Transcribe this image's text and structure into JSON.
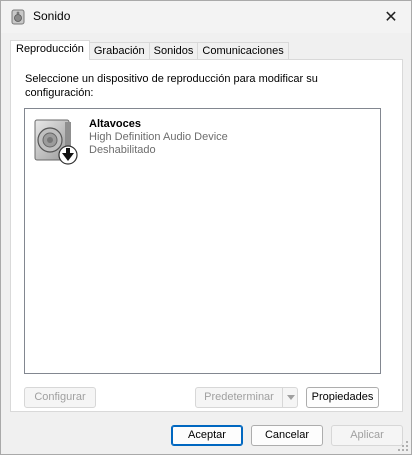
{
  "window": {
    "title": "Sonido",
    "close_glyph": "✕"
  },
  "tabs": [
    {
      "label": "Reproducción",
      "active": true
    },
    {
      "label": "Grabación",
      "active": false
    },
    {
      "label": "Sonidos",
      "active": false
    },
    {
      "label": "Comunicaciones",
      "active": false
    }
  ],
  "playback": {
    "instruction": "Seleccione un dispositivo de reproducción para modificar su configuración:",
    "devices": [
      {
        "name": "Altavoces",
        "description": "High Definition Audio Device",
        "status": "Deshabilitado",
        "icon": "speaker-icon",
        "overlay_icon": "disabled-arrow-icon"
      }
    ]
  },
  "buttons": {
    "configure": "Configurar",
    "set_default": "Predeterminar",
    "properties": "Propiedades",
    "ok": "Aceptar",
    "cancel": "Cancelar",
    "apply": "Aplicar"
  },
  "colors": {
    "accent": "#0067c0",
    "disabled_text": "#a0a0a0",
    "secondary_text": "#6d6d6d"
  }
}
